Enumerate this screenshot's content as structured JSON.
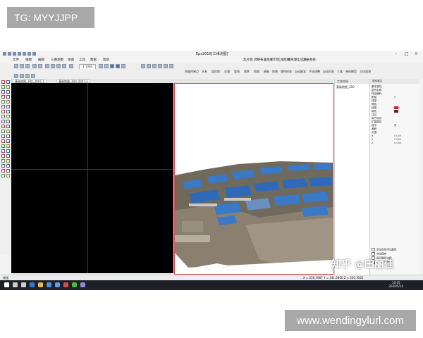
{
  "overlay": {
    "top_tag": "TG: MYYJJPP",
    "bottom_tag": "www.wendingylurl.com"
  },
  "titlebar": {
    "title": "Eps2016[三维测图]",
    "controls": [
      "–",
      "□",
      "×"
    ]
  },
  "menubar": {
    "items": [
      "文件",
      "视图",
      "编辑",
      "三维测图",
      "绘图",
      "工具",
      "数据",
      "帮助"
    ]
  },
  "topbar_links": [
    "瓦片图",
    "调整布置图层",
    "打印区域图层",
    "图形输出选项",
    "注册系统"
  ],
  "toolbar": {
    "scale_value": "1:1000",
    "row2_labels": [
      "测量控制点",
      "水系",
      "居民地",
      "交通",
      "管线",
      "境界",
      "地貌",
      "植被",
      "地物",
      "属性检查",
      "自动配准",
      "手动调整",
      "自动匹配",
      "三维",
      "单体模型",
      "立体观测"
    ]
  },
  "tabs": [
    {
      "label": "基础地图_300_2007.1"
    },
    {
      "label": "基础地图_300_2007.2"
    }
  ],
  "workspace_panel": {
    "title": "工作空间",
    "item": "基础地图_300"
  },
  "properties_panel": {
    "title": "属性窗口",
    "rows": [
      {
        "label": "基本属性",
        "value": ""
      },
      {
        "label": "层号名称",
        "value": ""
      },
      {
        "label": "特征编码",
        "value": ""
      },
      {
        "label": "图层",
        "value": "0"
      },
      {
        "label": "线型",
        "value": ""
      },
      {
        "label": "颜色",
        "value": ""
      },
      {
        "label": "线宽",
        "value": "0.00"
      },
      {
        "label": "填充",
        "value": ""
      },
      {
        "label": "注记",
        "value": ""
      },
      {
        "label": "用户标识",
        "value": ""
      },
      {
        "label": "扩展属性",
        "value": ""
      },
      {
        "label": "显示",
        "value": "是"
      },
      {
        "label": "面积",
        "value": ""
      },
      {
        "label": "长度",
        "value": ""
      },
      {
        "label": "X",
        "value": "0.000"
      },
      {
        "label": "Y",
        "value": "0.000"
      },
      {
        "label": "Z",
        "value": "0.000"
      }
    ],
    "swatch_colors": [
      "#b03030",
      "#7a1a1a"
    ],
    "checks": [
      "启动选择浮动属性",
      "自动保存",
      "显示图形边框",
      "注记文字修改"
    ]
  },
  "statusbar": {
    "left": "就绪",
    "coords": "X = 256.3987  Y = 341.2860  Z = 250.3560"
  },
  "taskbar": {
    "time": "10:45",
    "date": "2020/5/16",
    "icons": [
      "windows-icon",
      "search-icon",
      "taskview-icon",
      "edge-icon",
      "explorer-icon",
      "store-icon",
      "app-icon-1",
      "app-icon-2",
      "app-icon-3",
      "app-icon-4"
    ]
  },
  "watermark": "知乎 @田丽佳",
  "colors": {
    "window_bg": "#f3f3f3",
    "viewport_bg": "#000000",
    "active_view_border": "#e05050",
    "taskbar_bg": "#1f1f28",
    "roof_blue": "#3a78c8"
  }
}
